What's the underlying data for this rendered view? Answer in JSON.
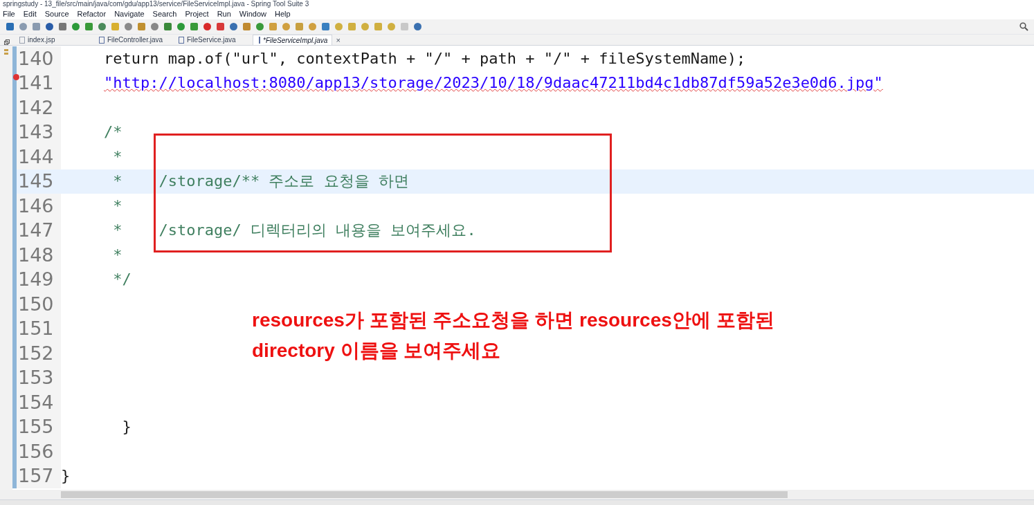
{
  "window": {
    "title": "springstudy - 13_file/src/main/java/com/gdu/app13/service/FileServiceImpl.java - Spring Tool Suite 3"
  },
  "menu": [
    "File",
    "Edit",
    "Source",
    "Refactor",
    "Navigate",
    "Search",
    "Project",
    "Run",
    "Window",
    "Help"
  ],
  "tabs": [
    {
      "label": "index.jsp",
      "kind": "jsp",
      "selected": false,
      "dirty": false
    },
    {
      "label": "FileController.java",
      "kind": "java",
      "selected": false,
      "dirty": false
    },
    {
      "label": "FileService.java",
      "kind": "java",
      "selected": false,
      "dirty": false
    },
    {
      "label": "*FileServiceImpl.java",
      "kind": "java",
      "selected": true,
      "dirty": true,
      "close": "×"
    }
  ],
  "editor": {
    "lines": [
      {
        "number": "140",
        "kind": "code",
        "text": "return map.of(\"url\", contextPath + \"/\" + path + \"/\" + fileSystemName);",
        "current": false,
        "error": false
      },
      {
        "number": "141",
        "kind": "string",
        "text": "\"http://localhost:8080/app13/storage/2023/10/18/9daac47211bd4c1db87df59a52e3e0d6.jpg\"",
        "current": false,
        "error": true
      },
      {
        "number": "142",
        "kind": "blank",
        "current": false,
        "error": false
      },
      {
        "number": "143",
        "kind": "comment",
        "text": "/*",
        "current": false,
        "error": false
      },
      {
        "number": "144",
        "kind": "comment",
        "text": " *",
        "current": false,
        "error": false
      },
      {
        "number": "145",
        "kind": "comment",
        "text": " *    /storage/** 주소로 요청을 하면",
        "current": true,
        "error": false
      },
      {
        "number": "146",
        "kind": "comment",
        "text": " *",
        "current": false,
        "error": false
      },
      {
        "number": "147",
        "kind": "comment",
        "text": " *    /storage/ 디렉터리의 내용을 보여주세요.",
        "current": false,
        "error": false
      },
      {
        "number": "148",
        "kind": "comment",
        "text": " *",
        "current": false,
        "error": false
      },
      {
        "number": "149",
        "kind": "comment",
        "text": " */",
        "current": false,
        "error": false
      },
      {
        "number": "150",
        "kind": "blank",
        "current": false,
        "error": false
      },
      {
        "number": "151",
        "kind": "blank",
        "current": false,
        "error": false
      },
      {
        "number": "152",
        "kind": "blank",
        "current": false,
        "error": false
      },
      {
        "number": "153",
        "kind": "blank",
        "current": false,
        "error": false
      },
      {
        "number": "154",
        "kind": "blank",
        "current": false,
        "error": false
      },
      {
        "number": "155",
        "kind": "code",
        "text": "  }",
        "current": false,
        "error": false
      },
      {
        "number": "156",
        "kind": "blank",
        "current": false,
        "error": false
      },
      {
        "number": "157",
        "kind": "brace",
        "text": "}",
        "current": false,
        "error": false
      }
    ]
  },
  "annotation": {
    "lines": [
      "resources가 포함된 주소요청을 하면 resources안에 포함된",
      "directory 이름을 보여주세요"
    ]
  }
}
